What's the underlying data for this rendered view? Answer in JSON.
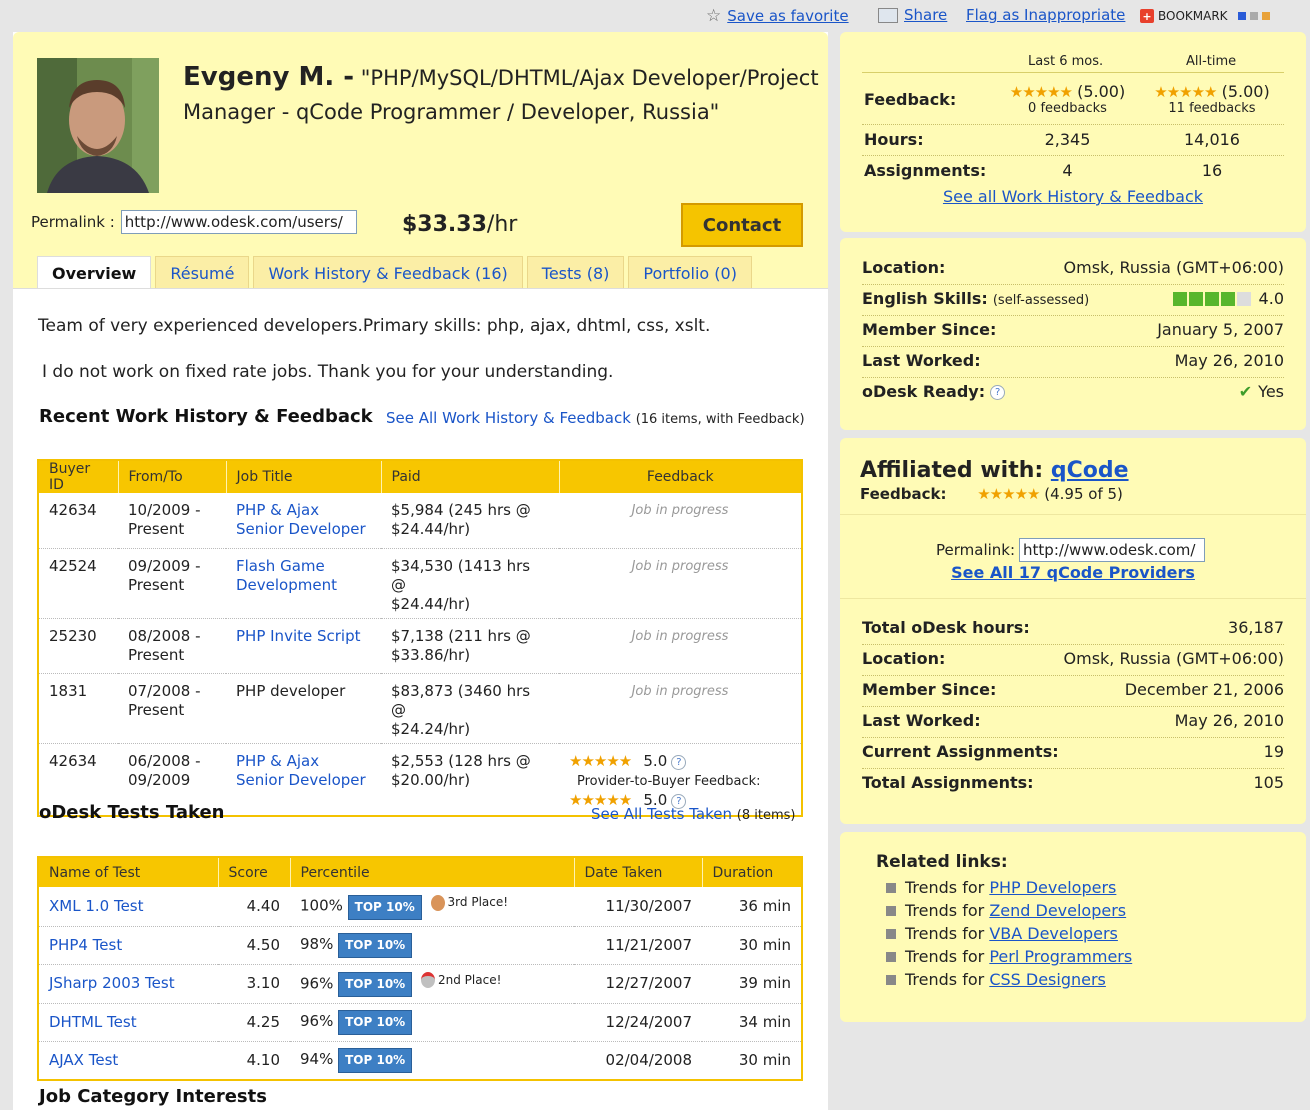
{
  "topbar": {
    "save_favorite": "Save as favorite",
    "share": "Share",
    "flag": "Flag as Inappropriate",
    "bookmark": "BOOKMARK"
  },
  "profile": {
    "name": "Evgeny M. -",
    "headline": "\"PHP/MySQL/DHTML/Ajax Developer/Project Manager - qCode Programmer / Developer, Russia\"",
    "permalink_label": "Permalink :",
    "permalink_value": "http://www.odesk.com/users/",
    "rate_amount": "$33.33",
    "rate_unit": "/hr",
    "contact_label": "Contact"
  },
  "tabs": [
    {
      "label": "Overview"
    },
    {
      "label": "Résumé"
    },
    {
      "label": "Work History & Feedback (16)"
    },
    {
      "label": "Tests (8)"
    },
    {
      "label": "Portfolio (0)"
    }
  ],
  "about": {
    "line1": "Team of very experienced developers.Primary skills: php, ajax, dhtml, css, xslt.",
    "line2": "I do not work on fixed rate jobs. Thank you for your understanding."
  },
  "work_history": {
    "title": "Recent Work History & Feedback",
    "link": "See All Work History & Feedback",
    "note": "(16 items, with Feedback)",
    "columns": [
      "Buyer ID",
      "From/To",
      "Job Title",
      "Paid",
      "Feedback"
    ],
    "rows": [
      {
        "buyer": "42634",
        "from": "10/2009 -",
        "to": "Present",
        "title": "PHP & Ajax Senior Developer",
        "paid1": "$5,984 (245 hrs @",
        "paid2": "$24.44/hr)",
        "feedback": "Job in progress"
      },
      {
        "buyer": "42524",
        "from": "09/2009 -",
        "to": "Present",
        "title": "Flash Game Development",
        "paid1": "$34,530 (1413 hrs @",
        "paid2": "$24.44/hr)",
        "feedback": "Job in progress"
      },
      {
        "buyer": "25230",
        "from": "08/2008 -",
        "to": "Present",
        "title": "PHP Invite Script",
        "paid1": "$7,138 (211 hrs @",
        "paid2": "$33.86/hr)",
        "feedback": "Job in progress"
      },
      {
        "buyer": "1831",
        "from": "07/2008 -",
        "to": "Present",
        "title": "PHP developer",
        "paid1": "$83,873 (3460 hrs @",
        "paid2": "$24.24/hr)",
        "feedback": "Job in progress"
      },
      {
        "buyer": "42634",
        "from": "06/2008 -",
        "to": "09/2009",
        "title": "PHP & Ajax Senior Developer",
        "paid1": "$2,553 (128 hrs @",
        "paid2": "$20.00/hr)",
        "score": "5.0",
        "ptb_label": "Provider-to-Buyer Feedback:",
        "ptb_score": "5.0"
      }
    ]
  },
  "tests": {
    "title": "oDesk Tests Taken",
    "link": "See All Tests Taken",
    "note": "(8 items)",
    "columns": [
      "Name of Test",
      "Score",
      "Percentile",
      "Date Taken",
      "Duration"
    ],
    "badge": "TOP 10%",
    "rows": [
      {
        "name": "XML 1.0 Test",
        "score": "4.40",
        "pct": "100%",
        "place": "3rd Place!",
        "date": "11/30/2007",
        "dur": "36 min"
      },
      {
        "name": "PHP4 Test",
        "score": "4.50",
        "pct": "98%",
        "place": "",
        "date": "11/21/2007",
        "dur": "30 min"
      },
      {
        "name": "JSharp 2003 Test",
        "score": "3.10",
        "pct": "96%",
        "place": "2nd Place!",
        "date": "12/27/2007",
        "dur": "39 min"
      },
      {
        "name": "DHTML Test",
        "score": "4.25",
        "pct": "96%",
        "place": "",
        "date": "12/24/2007",
        "dur": "34 min"
      },
      {
        "name": "AJAX Test",
        "score": "4.10",
        "pct": "94%",
        "place": "",
        "date": "02/04/2008",
        "dur": "30 min"
      }
    ]
  },
  "job_interests_title": "Job Category Interests",
  "stats": {
    "col1": "Last 6 mos.",
    "col2": "All-time",
    "feedback_label": "Feedback:",
    "fb6_score": "(5.00)",
    "fb6_count": "0 feedbacks",
    "fball_score": "(5.00)",
    "fball_count": "11 feedbacks",
    "hours_label": "Hours:",
    "hours6": "2,345",
    "hoursall": "14,016",
    "assign_label": "Assignments:",
    "assign6": "4",
    "assignall": "16",
    "link": "See all Work History & Feedback"
  },
  "info": {
    "location_label": "Location:",
    "location": "Omsk, Russia (GMT+06:00)",
    "english_label": "English Skills:",
    "english_note": "(self-assessed)",
    "english_value": "4.0",
    "member_label": "Member Since:",
    "member": "January 5, 2007",
    "worked_label": "Last Worked:",
    "worked": "May 26, 2010",
    "ready_label": "oDesk Ready:",
    "ready": "Yes"
  },
  "affiliate": {
    "label": "Affiliated with:",
    "company": "qCode",
    "feedback_label": "Feedback:",
    "feedback": "(4.95 of 5)",
    "permalink_label": "Permalink:",
    "permalink_value": "http://www.odesk.com/",
    "providers_link": "See All 17 qCode Providers",
    "total_hours_label": "Total oDesk hours:",
    "total_hours": "36,187",
    "location_label": "Location:",
    "location": "Omsk, Russia (GMT+06:00)",
    "member_label": "Member Since:",
    "member": "December 21, 2006",
    "worked_label": "Last Worked:",
    "worked": "May 26, 2010",
    "current_label": "Current Assignments:",
    "current": "19",
    "total_label": "Total Assignments:",
    "total": "105"
  },
  "related": {
    "title": "Related links:",
    "items": [
      {
        "prefix": "Trends for",
        "link": "PHP Developers"
      },
      {
        "prefix": "Trends for",
        "link": "Zend Developers"
      },
      {
        "prefix": "Trends for",
        "link": "VBA Developers"
      },
      {
        "prefix": "Trends for",
        "link": "Perl Programmers"
      },
      {
        "prefix": "Trends for",
        "link": "CSS Designers"
      }
    ]
  }
}
